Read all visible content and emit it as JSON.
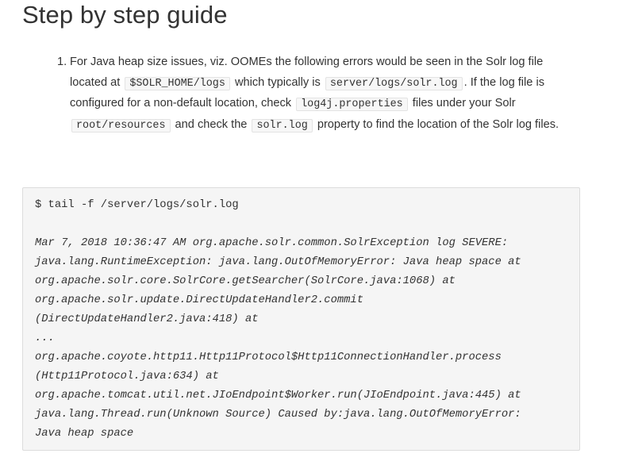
{
  "page": {
    "title": "Step by step guide"
  },
  "steps": [
    {
      "number": "1.",
      "segments": [
        {
          "type": "text",
          "value": "For Java heap size issues, viz. OOMEs the following errors would be seen in the Solr log file located at "
        },
        {
          "type": "code",
          "value": "$SOLR_HOME/logs"
        },
        {
          "type": "text",
          "value": " which typically is "
        },
        {
          "type": "code",
          "value": "server/logs/solr.log"
        },
        {
          "type": "text",
          "value": ". If the log file is configured for a non-default location, check "
        },
        {
          "type": "code",
          "value": "log4j.properties"
        },
        {
          "type": "text",
          "value": " files under your Solr "
        },
        {
          "type": "code",
          "value": "root/resources"
        },
        {
          "type": "text",
          "value": " and check the "
        },
        {
          "type": "code",
          "value": "solr.log"
        },
        {
          "type": "text",
          "value": " property to find the location of the Solr log files."
        }
      ]
    }
  ],
  "code_block": {
    "command": "$ tail -f /server/logs/solr.log",
    "output_lines": [
      "Mar 7, 2018 10:36:47 AM org.apache.solr.common.SolrException log SEVERE:",
      "java.lang.RuntimeException: java.lang.OutOfMemoryError: Java heap space at",
      "org.apache.solr.core.SolrCore.getSearcher(SolrCore.java:1068) at",
      "org.apache.solr.update.DirectUpdateHandler2.commit",
      "(DirectUpdateHandler2.java:418) at",
      "...",
      "org.apache.coyote.http11.Http11Protocol$Http11ConnectionHandler.process",
      "(Http11Protocol.java:634) at",
      "org.apache.tomcat.util.net.JIoEndpoint$Worker.run(JIoEndpoint.java:445) at",
      "java.lang.Thread.run(Unknown Source) Caused by:java.lang.OutOfMemoryError:",
      "Java heap space"
    ]
  }
}
